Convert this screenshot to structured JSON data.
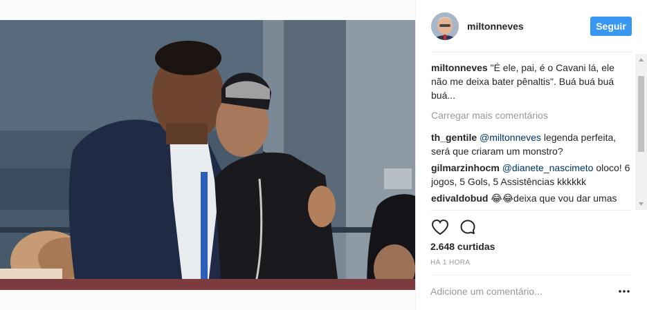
{
  "post": {
    "username": "miltonneves",
    "follow_label": "Seguir",
    "photo_description_icon": "photo"
  },
  "caption": {
    "username": "miltonneves",
    "text": "\"É ele, pai, é o Cavani lá, ele não me deixa bater pênaltis\". Buá buá buá buá..."
  },
  "load_more_label": "Carregar mais comentários",
  "comments": [
    {
      "username": "th_gentile",
      "mention": "@miltonneves",
      "text": " legenda perfeita, será que criaram um monstro?"
    },
    {
      "username": "gilmarzinhocm",
      "mention": "@dianete_nascimeto",
      "text": " oloco! 6 jogos, 5 Gols, 5 Assistências kkkkkk"
    },
    {
      "username": "edivaldobud",
      "mention": "",
      "text": " 😂😂deixa que vou dar umas palmadas nele filho !!!"
    }
  ],
  "likes": "2.648 curtidas",
  "time": "HÁ 1 HORA",
  "comment_input": {
    "placeholder": "Adicione um comentário..."
  },
  "icons": {
    "like": "heart-icon",
    "comment": "comment-icon",
    "more": "more-options-icon"
  },
  "colors": {
    "follow_button": "#3897f0",
    "mention": "#003569",
    "muted": "#999999"
  }
}
